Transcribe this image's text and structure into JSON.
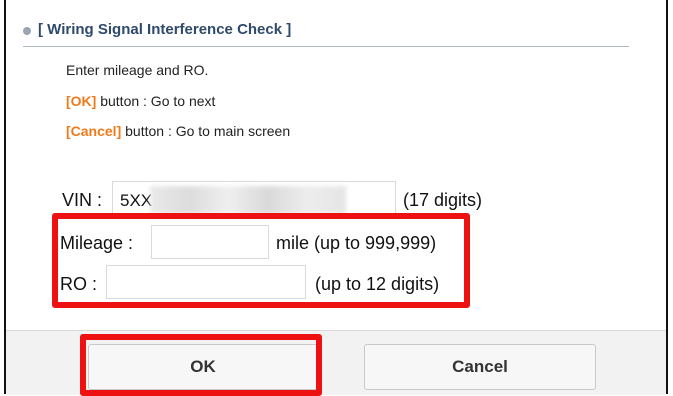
{
  "section": {
    "title": "[ Wiring Signal Interference Check ]"
  },
  "instructions": {
    "line1": "Enter mileage and RO.",
    "ok_ref": "[OK]",
    "ok_desc": " button : Go to next",
    "cancel_ref": "[Cancel]",
    "cancel_desc": " button : Go to main screen"
  },
  "form": {
    "vin": {
      "label": "VIN :",
      "value": "5XX",
      "hint": "(17 digits)"
    },
    "mileage": {
      "label": "Mileage :",
      "value": "",
      "hint": "mile (up to 999,999)"
    },
    "ro": {
      "label": "RO :",
      "value": "",
      "hint": "(up to 12 digits)"
    }
  },
  "buttons": {
    "ok_label": "OK",
    "cancel_label": "Cancel"
  },
  "colors": {
    "accent_orange": "#f07a1b",
    "highlight_red": "#ee1111",
    "title_blue": "#2f4a6b"
  }
}
